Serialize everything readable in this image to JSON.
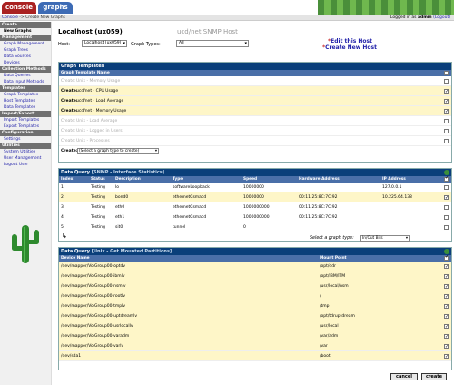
{
  "tabs": {
    "console": "console",
    "graphs": "graphs"
  },
  "nav": {
    "crumb_link": "Console",
    "crumb_rest": " -> Create New Graphs",
    "login_prefix": "Logged in as ",
    "user": "admin",
    "logout": " (Logout)"
  },
  "sidebar": [
    {
      "type": "head",
      "label": "Create"
    },
    {
      "type": "item",
      "label": "New Graphs",
      "active": true
    },
    {
      "type": "head",
      "label": "Management"
    },
    {
      "type": "item",
      "label": "Graph Management"
    },
    {
      "type": "item",
      "label": "Graph Trees"
    },
    {
      "type": "item",
      "label": "Data Sources"
    },
    {
      "type": "item",
      "label": "Devices"
    },
    {
      "type": "head",
      "label": "Collection Methods"
    },
    {
      "type": "item",
      "label": "Data Queries"
    },
    {
      "type": "item",
      "label": "Data Input Methods"
    },
    {
      "type": "head",
      "label": "Templates"
    },
    {
      "type": "item",
      "label": "Graph Templates"
    },
    {
      "type": "item",
      "label": "Host Templates"
    },
    {
      "type": "item",
      "label": "Data Templates"
    },
    {
      "type": "head",
      "label": "Import/Export"
    },
    {
      "type": "item",
      "label": "Import Templates"
    },
    {
      "type": "item",
      "label": "Export Templates"
    },
    {
      "type": "head",
      "label": "Configuration"
    },
    {
      "type": "item",
      "label": "Settings"
    },
    {
      "type": "head",
      "label": "Utilities"
    },
    {
      "type": "item",
      "label": "System Utilities"
    },
    {
      "type": "item",
      "label": "User Management"
    },
    {
      "type": "item",
      "label": "Logout User"
    }
  ],
  "header": {
    "host_title": "Localhost (ux059)",
    "template_title": "ucd/net SNMP Host",
    "host_label": "Host:",
    "host_value": "Localhost (ux059)",
    "graph_types_label": "Graph Types:",
    "graph_types_value": "All",
    "edit_host": "Edit this Host",
    "create_host": "Create New Host",
    "star": "*"
  },
  "graph_templates": {
    "title": "Graph Templates",
    "col": "Graph Template Name",
    "create_prefix": "Create:",
    "rows": [
      {
        "name": "Unix - Memory Usage",
        "enabled": false,
        "checked": false
      },
      {
        "name": "ucd/net - CPU Usage",
        "enabled": true,
        "checked": true
      },
      {
        "name": "ucd/net - Load Average",
        "enabled": true,
        "checked": true
      },
      {
        "name": "ucd/net - Memory Usage",
        "enabled": true,
        "checked": true
      },
      {
        "name": "Unix - Load Average",
        "enabled": false,
        "checked": false
      },
      {
        "name": "Unix - Logged in Users",
        "enabled": false,
        "checked": false
      },
      {
        "name": "Unix - Processes",
        "enabled": false,
        "checked": false
      }
    ],
    "select_label": "Create:",
    "select_value": "(Select a graph type to create)"
  },
  "dq1": {
    "title_prefix": "Data Query",
    "title_suffix": " [SNMP - Interface Statistics]",
    "cols": [
      "Index",
      "Status",
      "Description",
      "Type",
      "Speed",
      "Hardware Address",
      "IP Address"
    ],
    "rows": [
      {
        "c": [
          "1",
          "Testing",
          "lo",
          "softwareLoopback",
          "10000000",
          "",
          "127.0.0.1"
        ],
        "y": false,
        "checked": false
      },
      {
        "c": [
          "2",
          "Testing",
          "bond0",
          "ethernetCsmacd",
          "10000000",
          "00:11:25:8C:7C:92",
          "10.225.64.138"
        ],
        "y": true,
        "checked": true
      },
      {
        "c": [
          "3",
          "Testing",
          "eth0",
          "ethernetCsmacd",
          "1000000000",
          "00:11:25:8C:7C:92",
          ""
        ],
        "y": false,
        "checked": false
      },
      {
        "c": [
          "4",
          "Testing",
          "eth1",
          "ethernetCsmacd",
          "1000000000",
          "00:11:25:8C:7C:92",
          ""
        ],
        "y": false,
        "checked": false
      },
      {
        "c": [
          "5",
          "Testing",
          "sit0",
          "tunnel",
          "0",
          "",
          ""
        ],
        "y": false,
        "checked": false
      }
    ],
    "select_label": "Select a graph type:",
    "select_value": "In/Out Bits"
  },
  "dq2": {
    "title_prefix": "Data Query",
    "title_suffix": " [Unix - Get Mounted Partitions]",
    "cols": [
      "Device Name",
      "Mount Point"
    ],
    "rows": [
      {
        "c": [
          "/dev/mapper/VolGroup00-optdv",
          "/opt/ddr"
        ]
      },
      {
        "c": [
          "/dev/mapper/VolGroup00-ibmlv",
          "/opt/IBM/ITM"
        ]
      },
      {
        "c": [
          "/dev/mapper/VolGroup00-nsmlv",
          "/usr/local/nsm"
        ]
      },
      {
        "c": [
          "/dev/mapper/VolGroup00-rootlv",
          "/"
        ]
      },
      {
        "c": [
          "/dev/mapper/VolGroup00-tmplv",
          "/tmp"
        ]
      },
      {
        "c": [
          "/dev/mapper/VolGroup00-uptdreamlv",
          "/opt/tdruptdream"
        ]
      },
      {
        "c": [
          "/dev/mapper/VolGroup00-usrlocallv",
          "/usr/local"
        ]
      },
      {
        "c": [
          "/dev/mapper/VolGroup00-varadm",
          "/var/adm"
        ]
      },
      {
        "c": [
          "/dev/mapper/VolGroup00-varlv",
          "/var"
        ]
      },
      {
        "c": [
          "/dev/sda1",
          "/boot"
        ]
      }
    ]
  },
  "buttons": {
    "cancel": "cancel",
    "create": "create"
  }
}
